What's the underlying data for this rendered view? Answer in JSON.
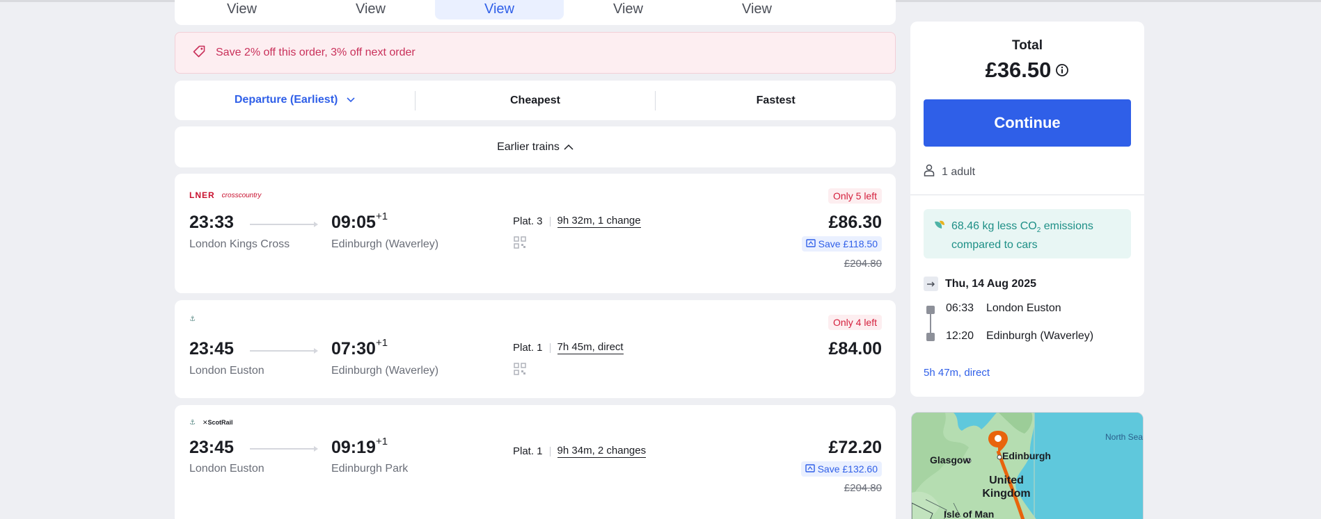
{
  "date_tabs": [
    {
      "label": "View",
      "active": false
    },
    {
      "label": "View",
      "active": false
    },
    {
      "label": "View",
      "active": true
    },
    {
      "label": "View",
      "active": false
    },
    {
      "label": "View",
      "active": false
    }
  ],
  "promo": {
    "text": "Save 2% off this order, 3% off next order"
  },
  "sort": {
    "departure": "Departure (Earliest)",
    "cheapest": "Cheapest",
    "fastest": "Fastest"
  },
  "earlier_trains": "Earlier trains",
  "journeys": [
    {
      "operators": [
        "LNER",
        "crosscountry"
      ],
      "dep_time": "23:33",
      "arr_time": "09:05",
      "day_offset": "+1",
      "dep_station": "London Kings Cross",
      "arr_station": "Edinburgh (Waverley)",
      "platform": "Plat. 3",
      "duration": "9h 32m, 1 change",
      "availability": "Only 5 left",
      "price": "£86.30",
      "save": "Save £118.50",
      "was_price": "£204.80"
    },
    {
      "operators": [
        "Caledonian Sleeper"
      ],
      "dep_time": "23:45",
      "arr_time": "07:30",
      "day_offset": "+1",
      "dep_station": "London Euston",
      "arr_station": "Edinburgh (Waverley)",
      "platform": "Plat. 1",
      "duration": "7h 45m, direct",
      "availability": "Only 4 left",
      "price": "£84.00"
    },
    {
      "operators": [
        "Caledonian Sleeper",
        "ScotRail"
      ],
      "dep_time": "23:45",
      "arr_time": "09:19",
      "day_offset": "+1",
      "dep_station": "London Euston",
      "arr_station": "Edinburgh Park",
      "platform": "Plat. 1",
      "duration": "9h 34m, 2 changes",
      "price": "£72.20",
      "save": "Save £132.60",
      "was_price": "£204.80"
    }
  ],
  "summary": {
    "total_label": "Total",
    "total_amount": "£36.50",
    "continue_label": "Continue",
    "passengers": "1 adult",
    "eco_line1": "68.46 kg less CO",
    "eco_sub": "2",
    "eco_line1_end": " emissions",
    "eco_line2": "compared to cars",
    "date": "Thu, 14 Aug 2025",
    "stops": [
      {
        "time": "06:33",
        "station": "London Euston"
      },
      {
        "time": "12:20",
        "station": "Edinburgh (Waverley)"
      }
    ],
    "duration": "5h 47m, direct"
  },
  "map": {
    "labels": {
      "glasgow": "Glasgow",
      "edinburgh": "Edinburgh",
      "uk_line1": "United",
      "uk_line2": "Kingdom",
      "isle_of_man": "Isle of Man",
      "north_sea": "North Sea"
    }
  },
  "colors": {
    "accent": "#2f5fe8",
    "promo": "#c9305a",
    "eco": "#1d8f86",
    "warning": "#d41f3c",
    "route": "#e8640c"
  }
}
